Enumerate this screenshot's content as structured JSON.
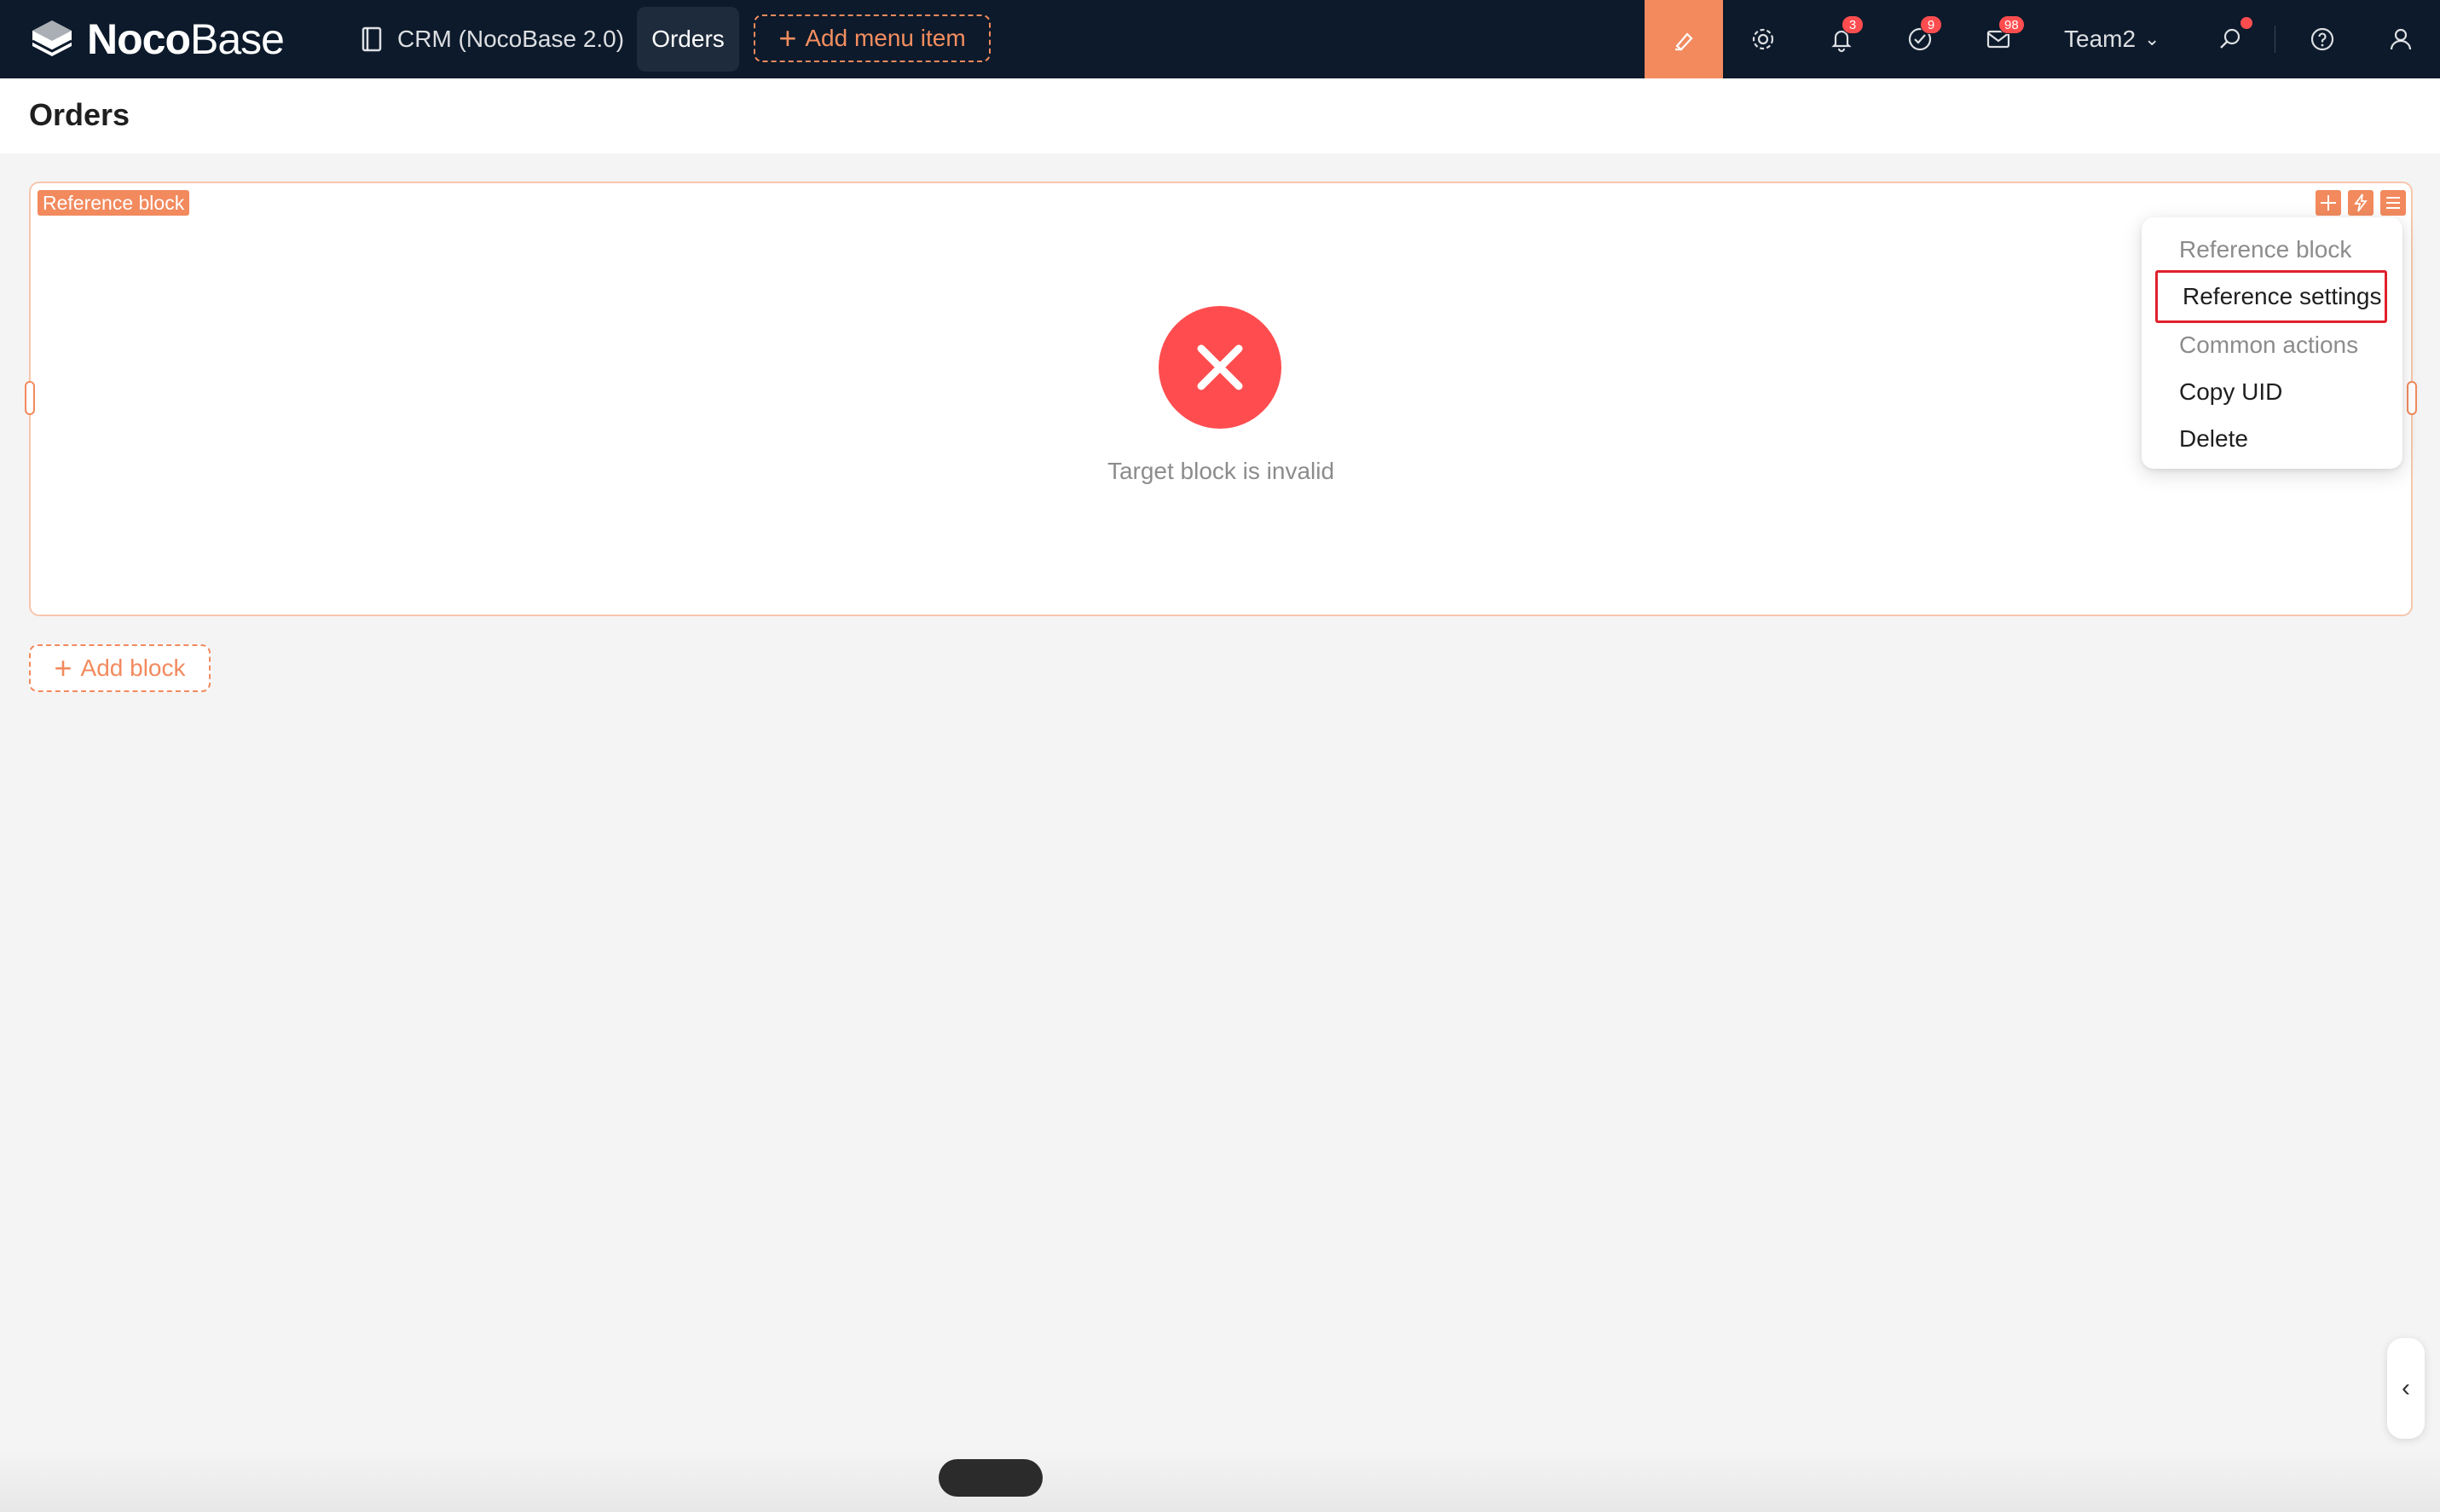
{
  "topbar": {
    "logo": {
      "bold": "Noco",
      "light": "Base",
      "icon": "nocobase-logo-icon"
    },
    "nav": {
      "crm": {
        "label": "CRM (NocoBase 2.0)",
        "icon": "book-icon"
      },
      "orders": {
        "label": "Orders"
      },
      "add_menu": {
        "label": "Add menu item"
      }
    },
    "icons": {
      "ui_editor": "ui-editor-icon",
      "settings": "gear-icon",
      "notifications": {
        "icon": "bell-icon",
        "badge": "3"
      },
      "tasks": {
        "icon": "check-circle-icon",
        "badge": "9"
      },
      "messages": {
        "icon": "mail-icon",
        "badge": "98"
      },
      "search": "search-icon",
      "help": "help-icon",
      "user": "user-icon"
    },
    "team": {
      "label": "Team2"
    }
  },
  "page": {
    "title": "Orders"
  },
  "block": {
    "tag": "Reference block",
    "error_text": "Target block is invalid"
  },
  "menu": {
    "items": [
      {
        "label": "Reference block",
        "type": "group"
      },
      {
        "label": "Reference settings",
        "type": "item",
        "highlighted": true
      },
      {
        "label": "Common actions",
        "type": "group"
      },
      {
        "label": "Copy UID",
        "type": "item"
      },
      {
        "label": "Delete",
        "type": "item"
      }
    ]
  },
  "add_block": {
    "label": "Add block"
  },
  "colors": {
    "topbar_bg": "#0c1a2b",
    "accent": "#f28a5e",
    "error": "#ff4d4f",
    "highlight_border": "#e0202c"
  }
}
